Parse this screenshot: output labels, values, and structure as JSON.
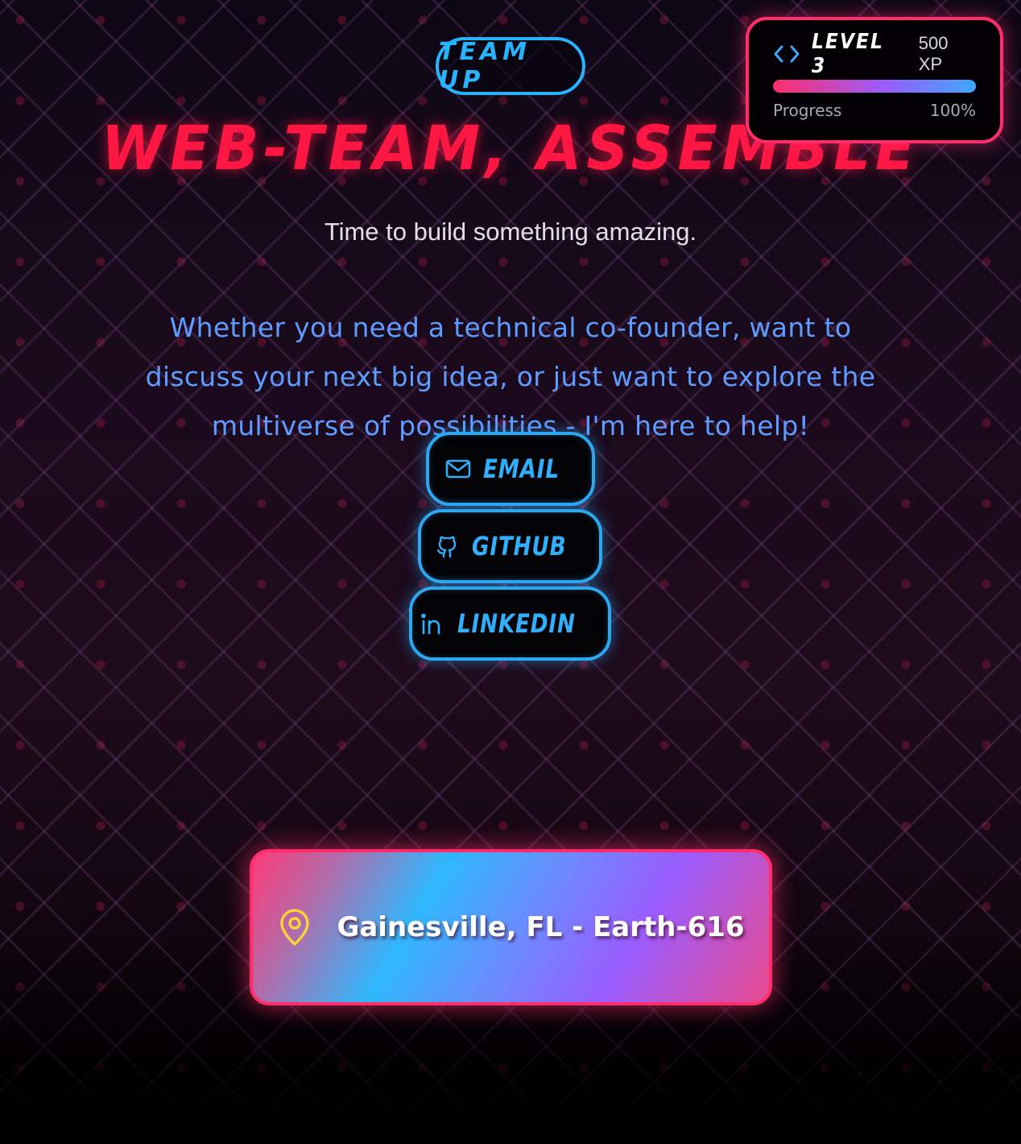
{
  "badge": {
    "label": "TEAM UP"
  },
  "hero": {
    "title": "WEB-TEAM, ASSEMBLE",
    "subtitle": "Time to build something amazing.",
    "paragraph": "Whether you need a technical co-founder, want to discuss your next big idea, or just want to explore the multiverse of possibilities - I'm here to help!"
  },
  "xp_card": {
    "icon": "code-icon",
    "level": "LEVEL 3",
    "xp": "500 XP",
    "progress_label": "Progress",
    "progress_value": "100%",
    "progress_fraction": 1.0
  },
  "contacts": [
    {
      "label": "EMAIL",
      "icon": "mail-icon"
    },
    {
      "label": "GITHUB",
      "icon": "github-icon"
    },
    {
      "label": "LINKEDIN",
      "icon": "linkedin-icon"
    }
  ],
  "location": {
    "icon": "map-pin-icon",
    "text": "Gainesville, FL - Earth-616"
  },
  "colors": {
    "accent_pink": "#ff2d6b",
    "title_red": "#ff1744",
    "accent_blue": "#2fb0ff",
    "paragraph_blue": "#5f9cff",
    "pin_yellow": "#ffd23a"
  }
}
